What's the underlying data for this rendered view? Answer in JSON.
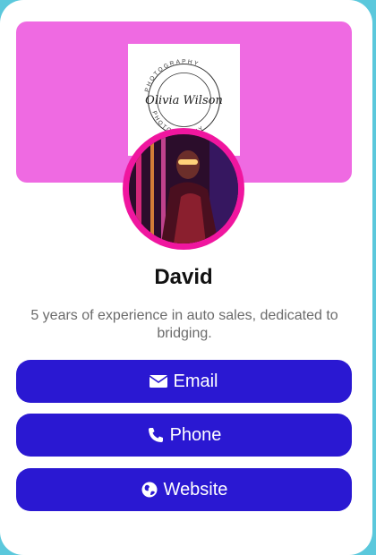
{
  "profile": {
    "name": "David",
    "bio": "5 years of experience in auto sales, dedicated to bridging.",
    "logo": {
      "script_text": "Olivia Wilson",
      "ring_top_text": "PHOTOGRAPHY",
      "ring_bottom_text": "PHOTOGRAPHY"
    }
  },
  "buttons": {
    "email": {
      "label": "Email",
      "icon": "envelope-icon"
    },
    "phone": {
      "label": "Phone",
      "icon": "phone-icon"
    },
    "website": {
      "label": "Website",
      "icon": "globe-icon"
    }
  },
  "colors": {
    "page_background": "#5bc8dc",
    "banner": "#ef6ae2",
    "avatar_ring": "#f0169f",
    "button": "#2a18d2"
  }
}
